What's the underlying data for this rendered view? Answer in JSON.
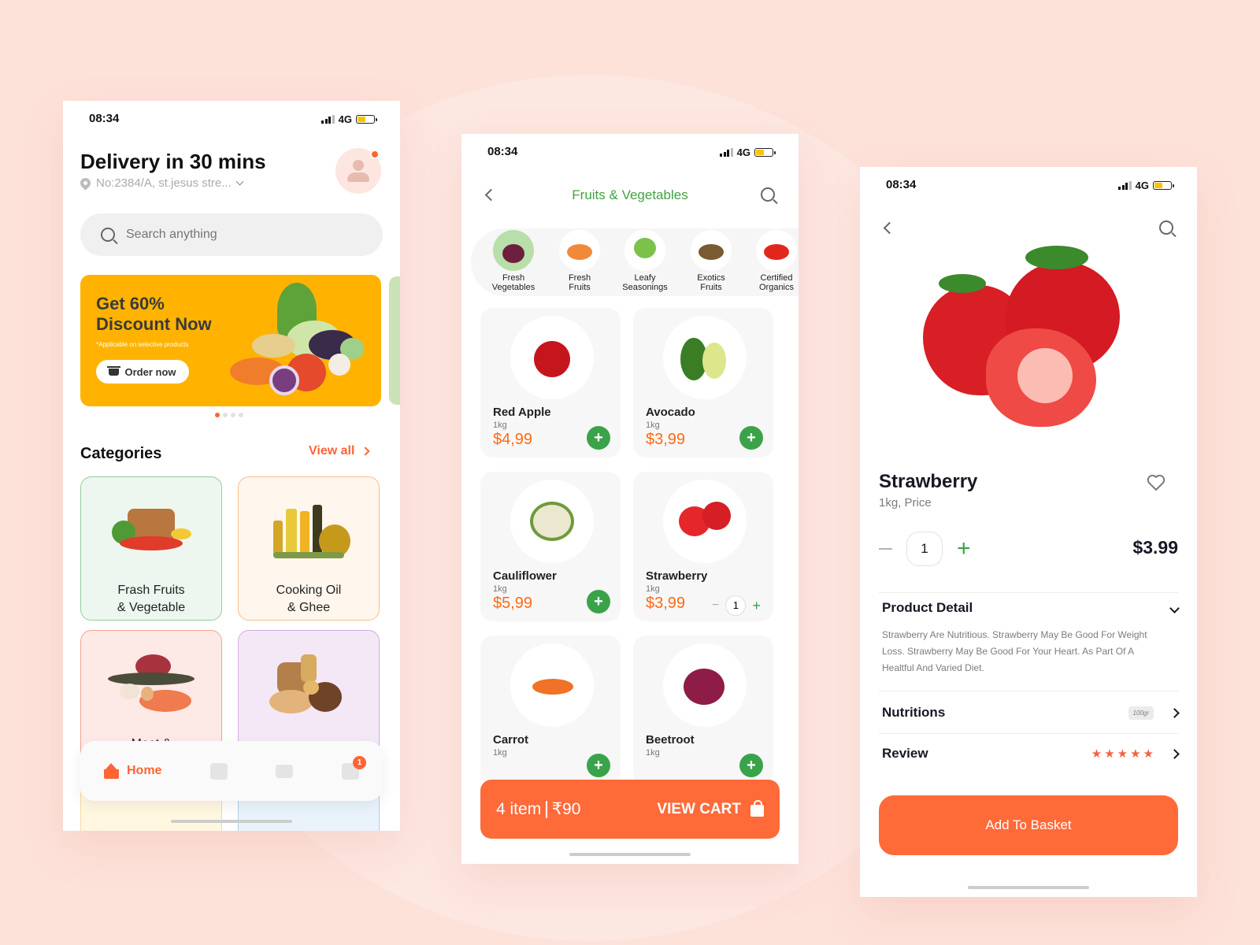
{
  "status_bar": {
    "time": "08:34",
    "network": "4G",
    "battery_fraction": 0.5
  },
  "home": {
    "title": "Delivery in 30 mins",
    "address": "No:2384/A, st.jesus stre...",
    "search": {
      "placeholder": "Search anything"
    },
    "banner": {
      "headline_1": "Get 60%",
      "headline_2": "Discount Now",
      "note": "*Applicable on selective products",
      "cta": "Order now",
      "page_count": 4,
      "active_page": 1
    },
    "categories": {
      "title": "Categories",
      "view_all": "View all",
      "items": [
        {
          "label_1": "Frash Fruits",
          "label_2": "& Vegetable"
        },
        {
          "label_1": "Cooking Oil",
          "label_2": "& Ghee"
        },
        {
          "label_1": "Meat &",
          "label_2": ""
        },
        {
          "label_1": "",
          "label_2": ""
        }
      ]
    },
    "bottom_nav": {
      "home_label": "Home",
      "cart_badge": "1"
    }
  },
  "listing": {
    "title": "Fruits & Vegetables",
    "subcategories": [
      {
        "line1": "Fresh",
        "line2": "Vegetables",
        "active": true
      },
      {
        "line1": "Fresh",
        "line2": "Fruits"
      },
      {
        "line1": "Leafy",
        "line2": "Seasonings"
      },
      {
        "line1": "Exotics",
        "line2": "Fruits"
      },
      {
        "line1": "Certified",
        "line2": "Organics"
      }
    ],
    "products": [
      {
        "name": "Red Apple",
        "weight": "1kg",
        "price": "$4,99"
      },
      {
        "name": "Avocado",
        "weight": "1kg",
        "price": "$3,99"
      },
      {
        "name": "Cauliflower",
        "weight": "1kg",
        "price": "$5,99"
      },
      {
        "name": "Strawberry",
        "weight": "1kg",
        "price": "$3,99",
        "qty": "1"
      },
      {
        "name": "Carrot",
        "weight": "1kg",
        "price": ""
      },
      {
        "name": "Beetroot",
        "weight": "1kg",
        "price": ""
      }
    ],
    "cart": {
      "items": "4 item",
      "total": "₹90",
      "cta": "VIEW CART"
    }
  },
  "detail": {
    "name": "Strawberry",
    "subtitle": "1kg, Price",
    "qty": "1",
    "price": "$3.99",
    "product_detail_title": "Product Detail",
    "description": "Strawberry Are Nutritious. Strawberry May Be Good For Weight Loss. Strawberry May Be Good For Your Heart. As Part Of A Healtful And Varied Diet.",
    "nutritions_title": "Nutritions",
    "nutritions_unit": "100gr",
    "review_title": "Review",
    "rating": 5,
    "cta": "Add To Basket"
  },
  "colors": {
    "accent": "#ff6a39",
    "green": "#3aa34a",
    "price": "#ff6a12"
  }
}
